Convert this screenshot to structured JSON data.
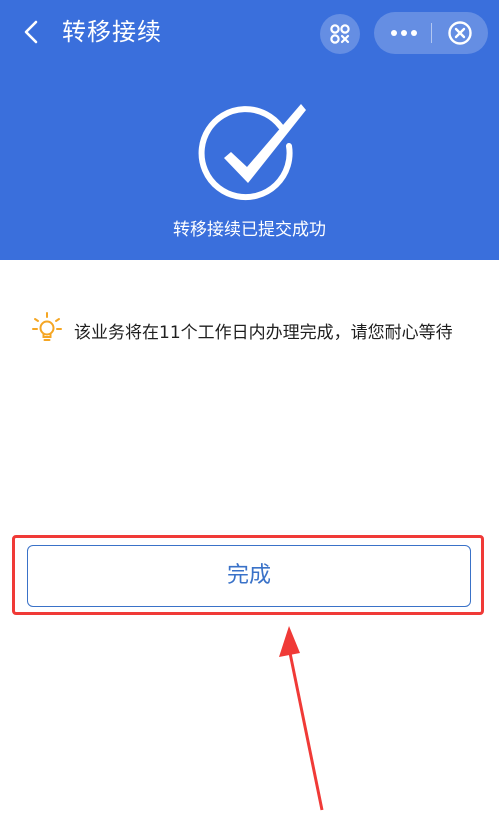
{
  "header": {
    "title": "转移接续",
    "back_icon": "chevron-left-icon",
    "scan_icon": "mini-program-qr-icon",
    "more_icon": "more-dots-icon",
    "close_icon": "close-circle-icon"
  },
  "status": {
    "icon": "check-circle-icon",
    "text": "转移接续已提交成功"
  },
  "tip": {
    "icon": "lightbulb-icon",
    "text": "该业务将在11个工作日内办理完成，请您耐心等待"
  },
  "actions": {
    "done_label": "完成"
  },
  "colors": {
    "header_bg": "#3a6fdc",
    "button_border": "#3a72c8",
    "highlight": "#f03a37",
    "tip_icon": "#f5a623"
  }
}
